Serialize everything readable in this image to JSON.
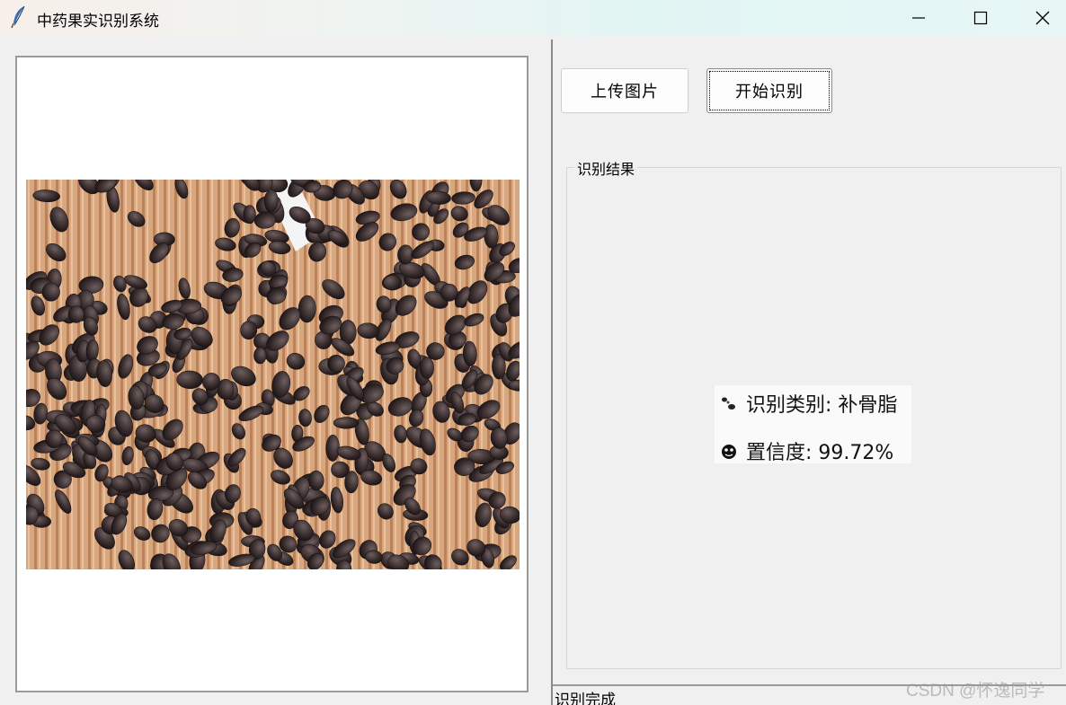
{
  "window": {
    "title": "中药果实识别系统",
    "app_icon": "feather-icon",
    "controls": [
      "minimize-icon",
      "maximize-icon",
      "close-icon"
    ]
  },
  "image_panel": {
    "image": "black-seeds-on-bamboo-mat-photo"
  },
  "toolbar": {
    "upload_label": "上传图片",
    "start_label": "开始识别"
  },
  "result_group": {
    "label": "识别结果",
    "category_text": "识别类别: 补骨脂",
    "confidence_text": "置信度: 99.72%",
    "category_icon": "paw-icon",
    "confidence_icon": "face-icon"
  },
  "status": {
    "text": "识别完成"
  },
  "watermark": "CSDN @怀逸同学",
  "colors": {
    "background": "#f0f0f0",
    "frame_border": "#9a9a9a",
    "titlebar_gradient_end": "#e1f5f3"
  }
}
